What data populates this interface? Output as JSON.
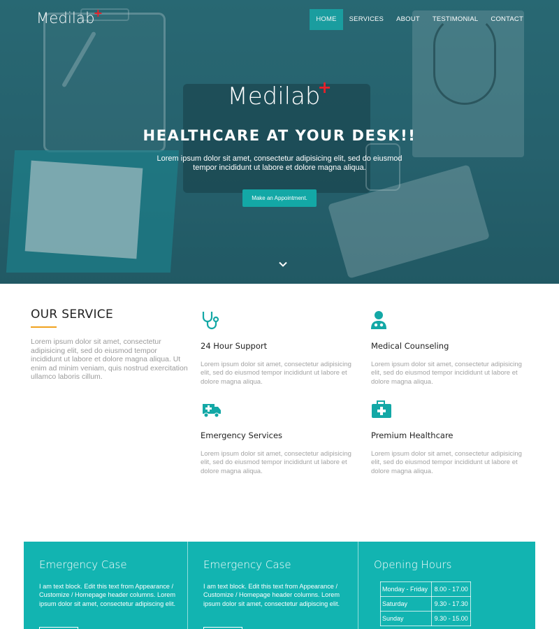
{
  "brand": {
    "name": "Medilab",
    "plus": "+",
    "accent": "#13a8a6",
    "plus_color": "#e8202a"
  },
  "nav": {
    "items": [
      {
        "label": "HOME",
        "active": true
      },
      {
        "label": "SERVICES",
        "active": false
      },
      {
        "label": "ABOUT",
        "active": false
      },
      {
        "label": "TESTIMONIAL",
        "active": false
      },
      {
        "label": "CONTACT",
        "active": false
      }
    ]
  },
  "hero": {
    "logo": "Medilab",
    "title": "HEALTHCARE AT YOUR DESK!!",
    "subtitle": "Lorem ipsum dolor sit amet, consectetur adipisicing elit, sed do eiusmod tempor incididunt ut labore et dolore magna aliqua.",
    "cta_label": "Make an Appointment.",
    "scroll_icon": "chevron-down-icon"
  },
  "services": {
    "heading": "OUR SERVICE",
    "intro": "Lorem ipsum dolor sit amet, consectetur adipisicing elit, sed do eiusmod tempor incididunt ut labore et dolore magna aliqua. Ut enim ad minim veniam, quis nostrud exercitation ullamco laboris cillum.",
    "items": [
      {
        "icon": "stethoscope-icon",
        "title": "24 Hour Support",
        "text": "Lorem ipsum dolor sit amet, consectetur adipisicing elit, sed do eiusmod tempor incididunt ut labore et dolore magna aliqua."
      },
      {
        "icon": "doctor-icon",
        "title": "Medical Counseling",
        "text": "Lorem ipsum dolor sit amet, consectetur adipisicing elit, sed do eiusmod tempor incididunt ut labore et dolore magna aliqua."
      },
      {
        "icon": "ambulance-icon",
        "title": "Emergency Services",
        "text": "Lorem ipsum dolor sit amet, consectetur adipisicing elit, sed do eiusmod tempor incididunt ut labore et dolore magna aliqua."
      },
      {
        "icon": "medkit-icon",
        "title": "Premium Healthcare",
        "text": "Lorem ipsum dolor sit amet, consectetur adipisicing elit, sed do eiusmod tempor incididunt ut labore et dolore magna aliqua."
      }
    ]
  },
  "band": {
    "col1": {
      "title": "Emergency Case",
      "text": "I am text block. Edit this text from Appearance / Customize / Homepage header columns. Lorem ipsum dolor sit amet, consectetur adipiscing elit."
    },
    "col2": {
      "title": "Emergency Case",
      "text": "I am text block. Edit this text from Appearance / Customize / Homepage header columns. Lorem ipsum dolor sit amet, consectetur adipiscing elit."
    },
    "col3": {
      "title": "Opening Hours",
      "rows": [
        {
          "day": "Monday - Friday",
          "time": "8.00 - 17.00"
        },
        {
          "day": "Saturday",
          "time": "9.30 - 17.30"
        },
        {
          "day": "Sunday",
          "time": "9.30 - 15.00"
        }
      ]
    }
  }
}
